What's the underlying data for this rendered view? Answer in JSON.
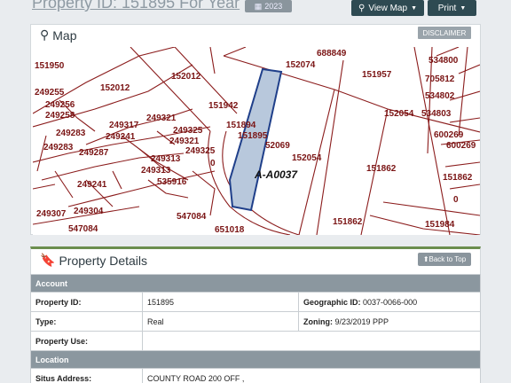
{
  "header": {
    "title": "Property ID: 151895 For Year",
    "year_select": "2023",
    "view_map_label": "View Map",
    "print_label": "Print"
  },
  "map_panel": {
    "title": "Map",
    "disclaimer_label": "DISCLAIMER",
    "map_labels": {
      "abstract": "A-A0037",
      "parcels": [
        "688849",
        "152074",
        "534800",
        "151950",
        "152012",
        "151957",
        "705812",
        "249255",
        "152012",
        "534802",
        "249256",
        "249258",
        "151942",
        "152054",
        "534803",
        "249317",
        "249321",
        "151894",
        "249283",
        "249241",
        "249325",
        "249321",
        "151895",
        "600269",
        "249283",
        "249287",
        "249313",
        "249325",
        "52069",
        "600269",
        "0",
        "152054",
        "151862",
        "249313",
        "151862",
        "249241",
        "535916",
        "0",
        "249307",
        "249304",
        "547084",
        "151862",
        "151984",
        "547084",
        "651018"
      ]
    },
    "colors": {
      "parcel_line": "#8b1c1c",
      "highlight_fill": "#b8c8dc",
      "highlight_stroke": "#1f3f8a"
    }
  },
  "details_panel": {
    "title": "Property Details",
    "back_to_top_label": "Back to Top",
    "sections": {
      "account": "Account",
      "location": "Location"
    },
    "rows": {
      "property_id_label": "Property ID:",
      "property_id_value": "151895",
      "geographic_id_label": "Geographic ID:",
      "geographic_id_value": "0037-0066-000",
      "type_label": "Type:",
      "type_value": "Real",
      "zoning_label": "Zoning:",
      "zoning_value": "9/23/2019 PPP",
      "property_use_label": "Property Use:",
      "property_use_value": "",
      "situs_address_label": "Situs Address:",
      "situs_address_value": "COUNTY ROAD 200 OFF   ,"
    }
  }
}
